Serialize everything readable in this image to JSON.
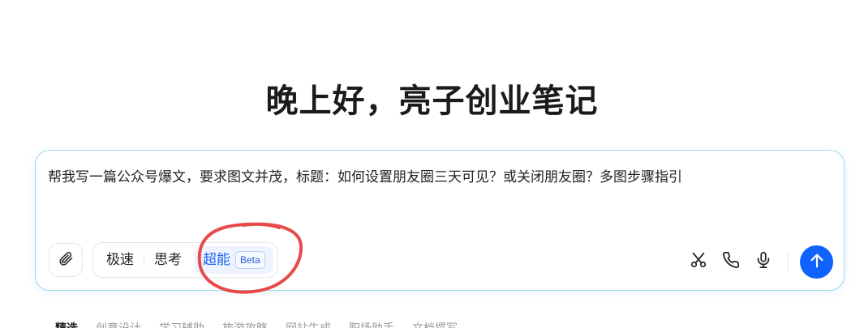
{
  "greeting": "晚上好，亮子创业笔记",
  "composer": {
    "prompt_text": "帮我写一篇公众号爆文，要求图文并茂，标题：如何设置朋友圈三天可见？或关闭朋友圈？多图步骤指引",
    "modes": [
      {
        "label": "极速"
      },
      {
        "label": "思考"
      },
      {
        "label": "超能",
        "badge": "Beta",
        "selected": true
      }
    ],
    "icons": {
      "attach": "paperclip-icon",
      "cut": "scissors-icon",
      "call": "phone-icon",
      "voice": "microphone-icon",
      "send": "arrow-up-icon"
    },
    "accent_color": "#0f62fe",
    "annotation_color": "#e84a4a"
  },
  "bottom_tabs": [
    "精选",
    "创意设计",
    "学习辅助",
    "旅游攻略",
    "网站生成",
    "职场助手",
    "文档撰写"
  ]
}
